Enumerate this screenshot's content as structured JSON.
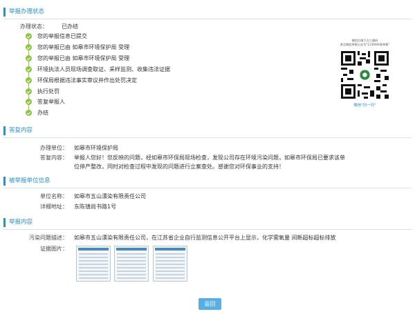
{
  "status_section": {
    "title": "举报办理状态",
    "status_label": "办理状态：",
    "status_value": "已办结",
    "steps": [
      "您的举报信息已提交",
      "您的举报已由 如皋市环境保护局 受理",
      "您的举报已由 如皋市环境保护局 受理",
      "环境执法人员现场调查取证、采样监测、收集违法证据",
      "环保局根据违法事实审议并作出处罚决定",
      "执行处罚",
      "答复举报人",
      "办结"
    ],
    "qr": {
      "caption_line1": "微信扫描下方二维码",
      "caption_line2": "关注微信举报公众号\"12369环保举报\"",
      "footer": "微信\"扫一扫\""
    }
  },
  "reply_section": {
    "title": "答复内容",
    "unit_label": "办理单位：",
    "unit_value": "如皋市环境保护局",
    "content_label": "答复内容：",
    "content_line1": "举报人您好！您反映的问题，经如皋市环保局现场检查，发现公司存在环境污染问题，如皋市环保局已要求该单",
    "content_line2": "位停产整改，同时对检查过程中发现的问题进行立案查处。感谢您对环保事业的支持！"
  },
  "unit_section": {
    "title": "被举报单位信息",
    "name_label": "单位名称：",
    "name_value": "如皋市五山漂染有限责任公司",
    "address_label": "详细地址：",
    "address_value": "东陈镇尚书路1号"
  },
  "report_section": {
    "title": "举报内容",
    "desc_label": "污染问题描述：",
    "desc_value": "如皋市五山漂染有限责任公司，在江苏省企业自行监测信息公开平台上显示，化学需氧量 间断超标超标排放",
    "images_label": "证据图片："
  },
  "back_button": "返回"
}
